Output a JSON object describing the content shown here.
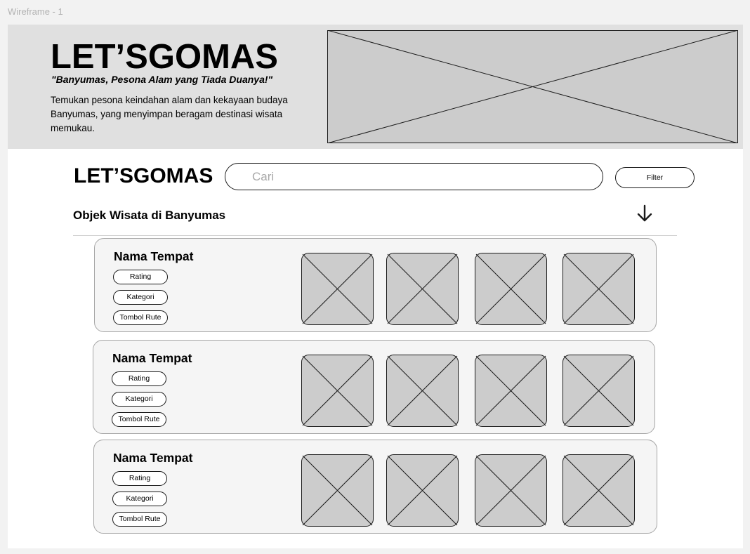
{
  "frame_label": "Wireframe - 1",
  "hero": {
    "title": "LET’SGOMAS",
    "tagline": "\"Banyumas, Pesona Alam yang Tiada Duanya!\"",
    "description": "Temukan pesona keindahan alam dan kekayaan budaya Banyumas,  yang menyimpan beragam destinasi wisata memukau.",
    "image_icon": "image-placeholder-icon"
  },
  "search": {
    "logo": "LET’SGOMAS",
    "placeholder": "Cari",
    "filter_label": "Filter"
  },
  "section": {
    "title": "Objek Wisata di Banyumas",
    "arrow_icon": "arrow-down-icon"
  },
  "cards": [
    {
      "name": "Nama Tempat",
      "rating_label": "Rating",
      "category_label": "Kategori",
      "route_label": "Tombol Rute"
    },
    {
      "name": "Nama Tempat",
      "rating_label": "Rating",
      "category_label": "Kategori",
      "route_label": "Tombol Rute"
    },
    {
      "name": "Nama Tempat",
      "rating_label": "Rating",
      "category_label": "Kategori",
      "route_label": "Tombol Rute"
    }
  ],
  "colors": {
    "placeholder_fill": "#cccccc",
    "hero_bg": "#e0e0e0",
    "card_bg": "#f5f5f5"
  }
}
